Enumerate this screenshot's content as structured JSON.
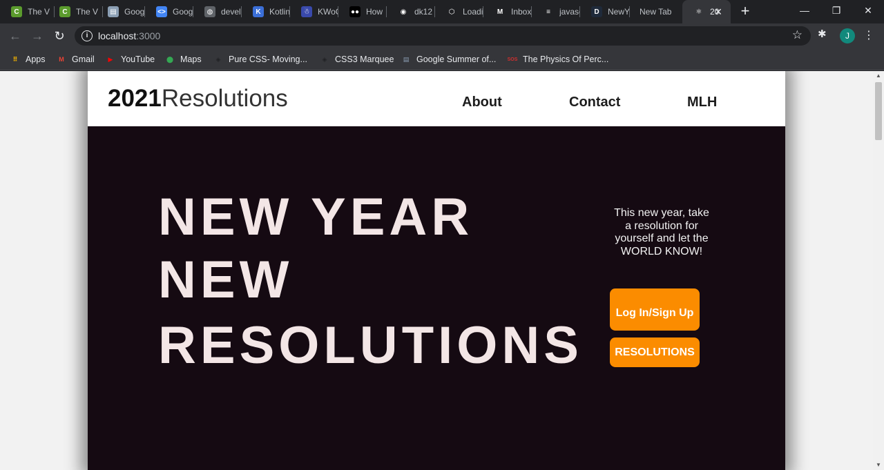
{
  "browser": {
    "tabs": [
      {
        "title": "The V",
        "icon": "codechef-icon",
        "color": "#5b9b2d",
        "glyph": "C"
      },
      {
        "title": "The V",
        "icon": "codechef-icon",
        "color": "#5b9b2d",
        "glyph": "C"
      },
      {
        "title": "Goog",
        "icon": "google-doc-icon",
        "color": "#8b9fb4",
        "glyph": "▤"
      },
      {
        "title": "Goog",
        "icon": "google-code-icon",
        "color": "#4285f4",
        "glyph": "<>"
      },
      {
        "title": "devel",
        "icon": "globe-icon",
        "color": "#5f6368",
        "glyph": "◍"
      },
      {
        "title": "Kotlin",
        "icon": "kotlin-icon",
        "color": "#3b6fd8",
        "glyph": "K"
      },
      {
        "title": "KWoC",
        "icon": "kwoc-icon",
        "color": "#3949ab",
        "glyph": "☃"
      },
      {
        "title": "How",
        "icon": "medium-icon",
        "color": "#000000",
        "glyph": "●●"
      },
      {
        "title": "dk12",
        "icon": "github-icon",
        "color": "#202124",
        "glyph": "◉"
      },
      {
        "title": "Loadi",
        "icon": "box-icon",
        "color": "#202124",
        "glyph": "⬡"
      },
      {
        "title": "Inbox",
        "icon": "gmail-icon",
        "color": "#202124",
        "glyph": "M"
      },
      {
        "title": "javasc",
        "icon": "stackoverflow-icon",
        "color": "#202124",
        "glyph": "≡"
      },
      {
        "title": "NewY",
        "icon": "d-letter-icon",
        "color": "#1f2a3a",
        "glyph": "D"
      },
      {
        "title": "New Tab",
        "icon": "",
        "color": "",
        "glyph": ""
      },
      {
        "title": "20",
        "icon": "react-icon",
        "color": "#35363a",
        "glyph": "⚛"
      }
    ],
    "new_tab_symbol": "+",
    "window_controls": {
      "minimize": "—",
      "restore": "❐",
      "close": "✕"
    },
    "nav": {
      "back": "←",
      "forward": "→",
      "reload": "↻"
    },
    "url_host": "localhost",
    "url_port": ":3000",
    "info_glyph": "i",
    "star_glyph": "☆",
    "extensions_glyph": "✱",
    "profile_initial": "J",
    "menu_glyph": "⋮",
    "bookmarks": [
      {
        "label": "Apps",
        "icon": "apps-grid-icon",
        "color": "#f4b400",
        "glyph": "⠿"
      },
      {
        "label": "Gmail",
        "icon": "gmail-icon",
        "color": "#ea4335",
        "glyph": "M"
      },
      {
        "label": "YouTube",
        "icon": "youtube-icon",
        "color": "#ff0000",
        "glyph": "▶"
      },
      {
        "label": "Maps",
        "icon": "maps-pin-icon",
        "color": "#34a853",
        "glyph": "⬤"
      },
      {
        "label": "Pure CSS- Moving...",
        "icon": "codepen-icon",
        "color": "#202124",
        "glyph": "◈"
      },
      {
        "label": "CSS3 Marquee",
        "icon": "codepen-icon",
        "color": "#202124",
        "glyph": "◈"
      },
      {
        "label": "Google Summer of...",
        "icon": "google-doc-icon",
        "color": "#8b9fb4",
        "glyph": "▤"
      },
      {
        "label": "The Physics Of Perc...",
        "icon": "sos-icon",
        "color": "#d32f2f",
        "glyph": "SOS"
      }
    ]
  },
  "site": {
    "logo_year": "2021",
    "logo_word": "Resolutions",
    "nav": [
      "About",
      "Contact",
      "MLH"
    ],
    "hero_lines": [
      "NEW YEAR",
      "NEW",
      "RESOLUTIONS"
    ],
    "tagline": "This new year, take a resolution for yourself and let the WORLD KNOW!",
    "login_label": "Log In/Sign Up",
    "resolutions_label": "RESOLUTIONS",
    "accent_color": "#fb8c00",
    "hero_bg": "#150a12"
  }
}
